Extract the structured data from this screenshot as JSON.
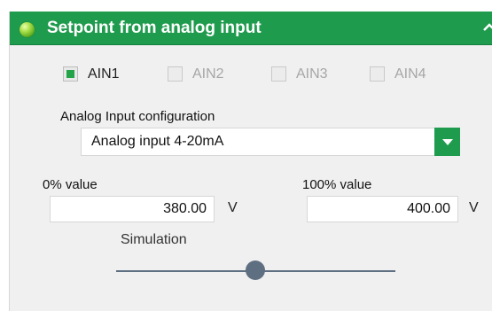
{
  "header": {
    "title": "Setpoint from analog input"
  },
  "inputs": [
    {
      "label": "AIN1",
      "checked": true
    },
    {
      "label": "AIN2",
      "checked": false
    },
    {
      "label": "AIN3",
      "checked": false
    },
    {
      "label": "AIN4",
      "checked": false
    }
  ],
  "config": {
    "label": "Analog Input configuration",
    "selected": "Analog input 4-20mA"
  },
  "zero": {
    "label": "0% value",
    "value": "380.00",
    "unit": "V"
  },
  "full": {
    "label": "100% value",
    "value": "400.00",
    "unit": "V"
  },
  "simulation": {
    "label": "Simulation",
    "position": 0.5
  },
  "colors": {
    "accent": "#1f9b4d",
    "check": "#23a448",
    "slider": "#5f6f82"
  },
  "icons": {
    "status": "green-led-icon",
    "collapse": "chevron-up-icon",
    "dropdown": "dropdown-arrow-icon"
  }
}
